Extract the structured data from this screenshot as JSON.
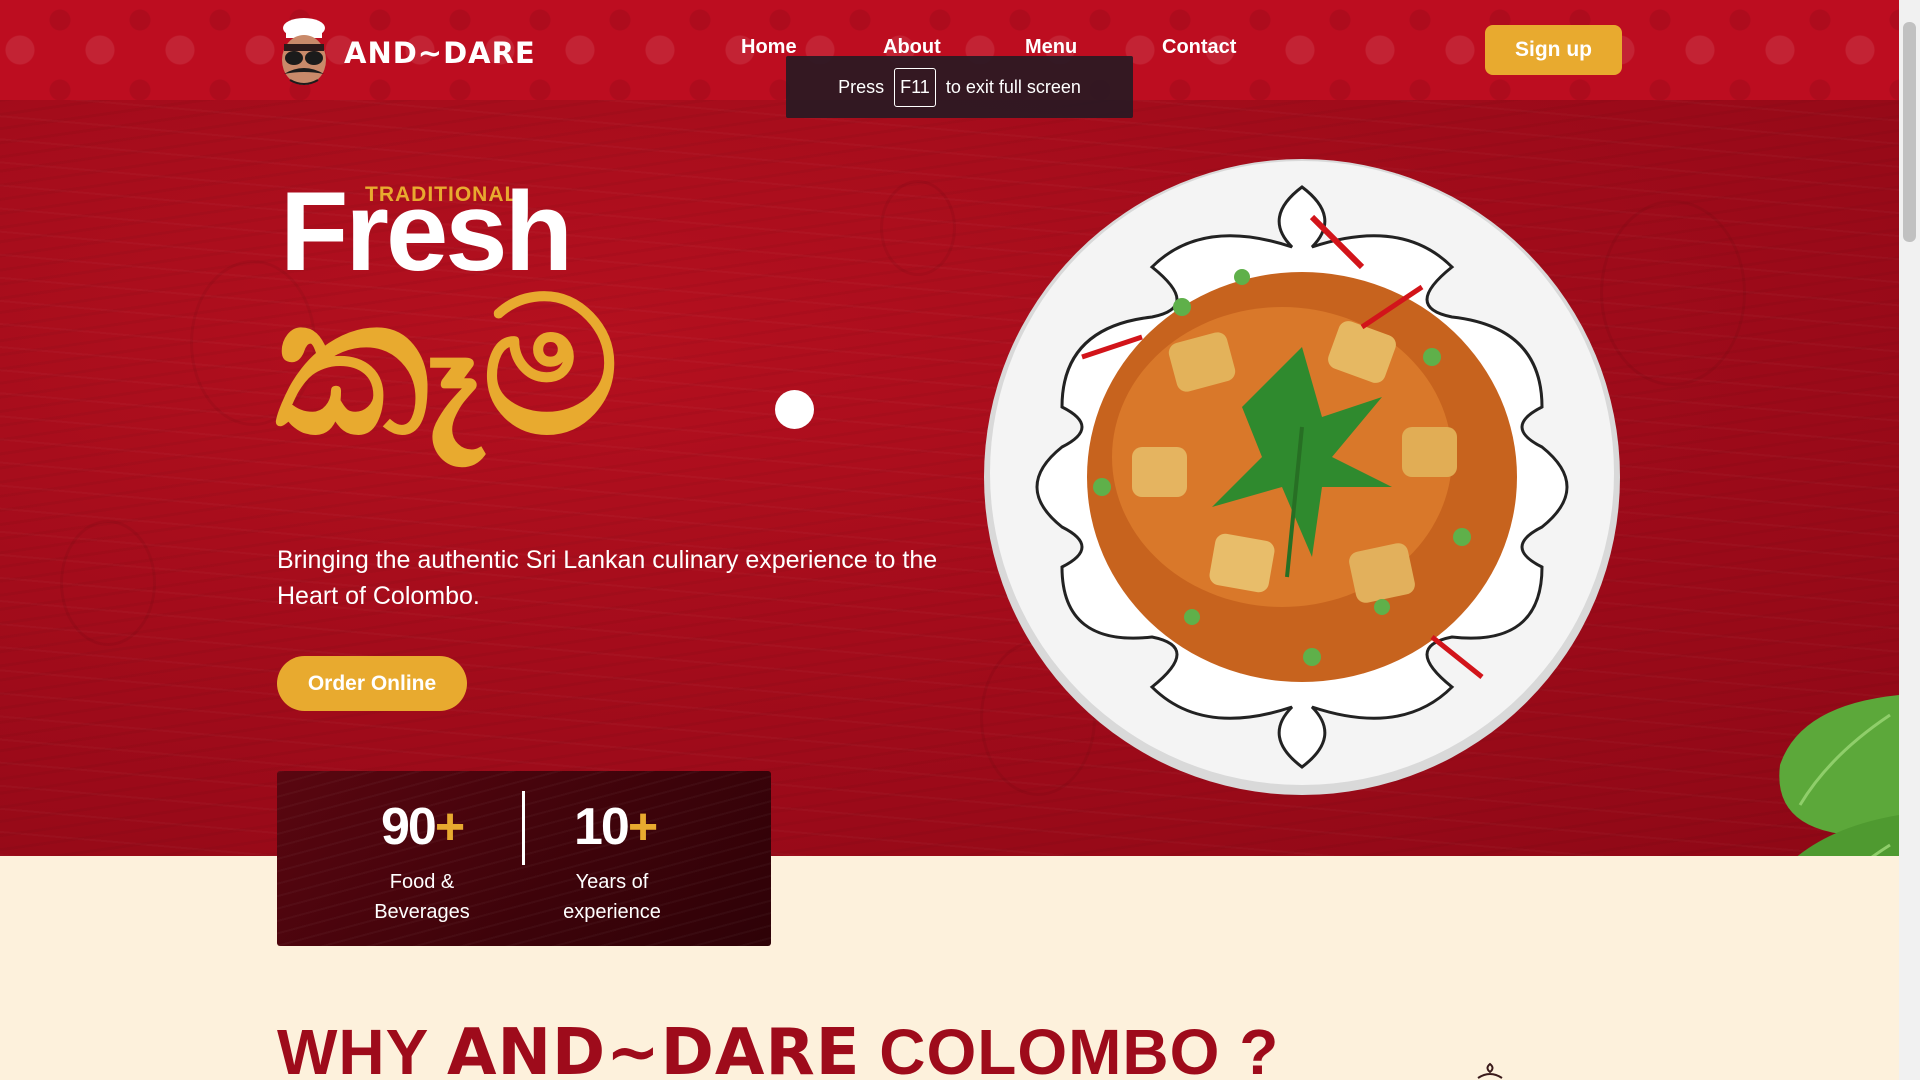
{
  "brand": {
    "name": "AND~DARE"
  },
  "nav": {
    "items": [
      "Home",
      "About",
      "Menu",
      "Contact"
    ],
    "signup_label": "Sign up"
  },
  "fullscreen_toast": {
    "before": "Press",
    "key": "F11",
    "after": "to exit full screen"
  },
  "hero": {
    "kicker": "TRADITIONAL",
    "headline": "Fresh",
    "headline_sinhala": "කෑම",
    "tagline": "Bringing the authentic Sri Lankan culinary experience to the Heart of Colombo.",
    "cta_label": "Order Online"
  },
  "stats": [
    {
      "number": "90",
      "suffix": "+",
      "label_line1": "Food &",
      "label_line2": "Beverages"
    },
    {
      "number": "10",
      "suffix": "+",
      "label_line1": "Years of",
      "label_line2": "experience"
    }
  ],
  "why": {
    "prefix": "WHY",
    "brand": "AND~DARE",
    "suffix": "COLOMBO ?"
  },
  "colors": {
    "hero_red": "#a80c1c",
    "accent_gold": "#e8aa2f",
    "cream": "#fdf1dc",
    "stats_dark": "#4a040c"
  },
  "icons": [
    "chef-logo-icon",
    "dish-plate-image",
    "mint-leaf-image",
    "flower-icon"
  ]
}
